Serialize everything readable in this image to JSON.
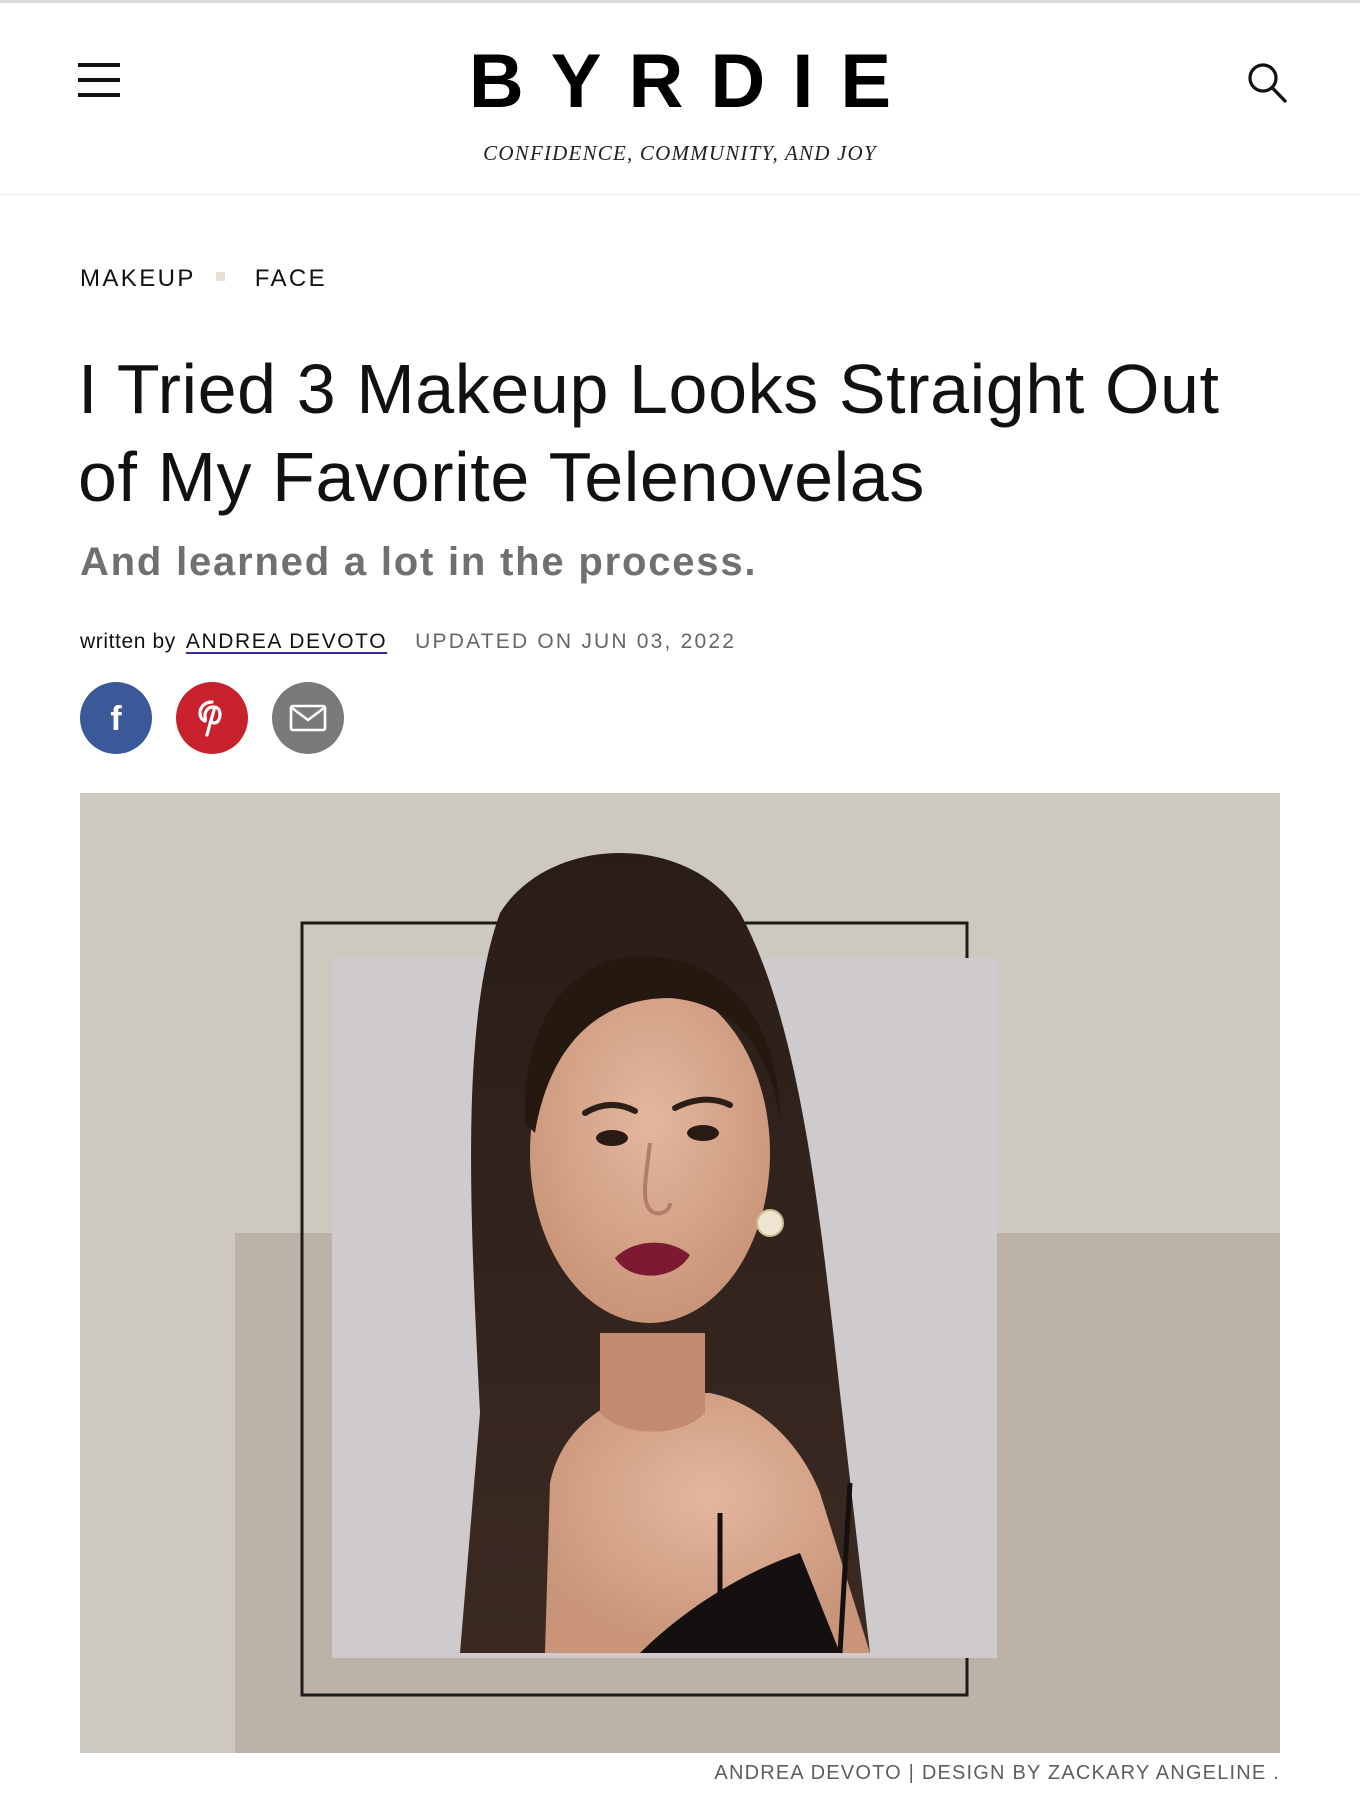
{
  "header": {
    "logo": "BYRDIE",
    "tagline": "CONFIDENCE, COMMUNITY, AND JOY",
    "menu_icon": "hamburger-icon",
    "search_icon": "search-icon"
  },
  "breadcrumb": {
    "items": [
      {
        "label": "MAKEUP"
      },
      {
        "label": "FACE"
      }
    ]
  },
  "article": {
    "title": "I Tried 3 Makeup Looks Straight Out of My Favorite Telenovelas",
    "subtitle": "And learned a lot in the process.",
    "byline": {
      "written_by": "written by",
      "author": "ANDREA DEVOTO",
      "updated": "UPDATED ON JUN 03, 2022"
    },
    "share": {
      "facebook_icon": "facebook-icon",
      "pinterest_icon": "pinterest-icon",
      "email_icon": "email-icon"
    },
    "hero_credit": "ANDREA DEVOTO | DESIGN BY ZACKARY ANGELINE ."
  },
  "colors": {
    "facebook": "#3b5998",
    "pinterest": "#c8232c",
    "email": "#7a7a7a",
    "hero_bg": "#cfcac2",
    "author_underline": "#3b2b8e"
  }
}
